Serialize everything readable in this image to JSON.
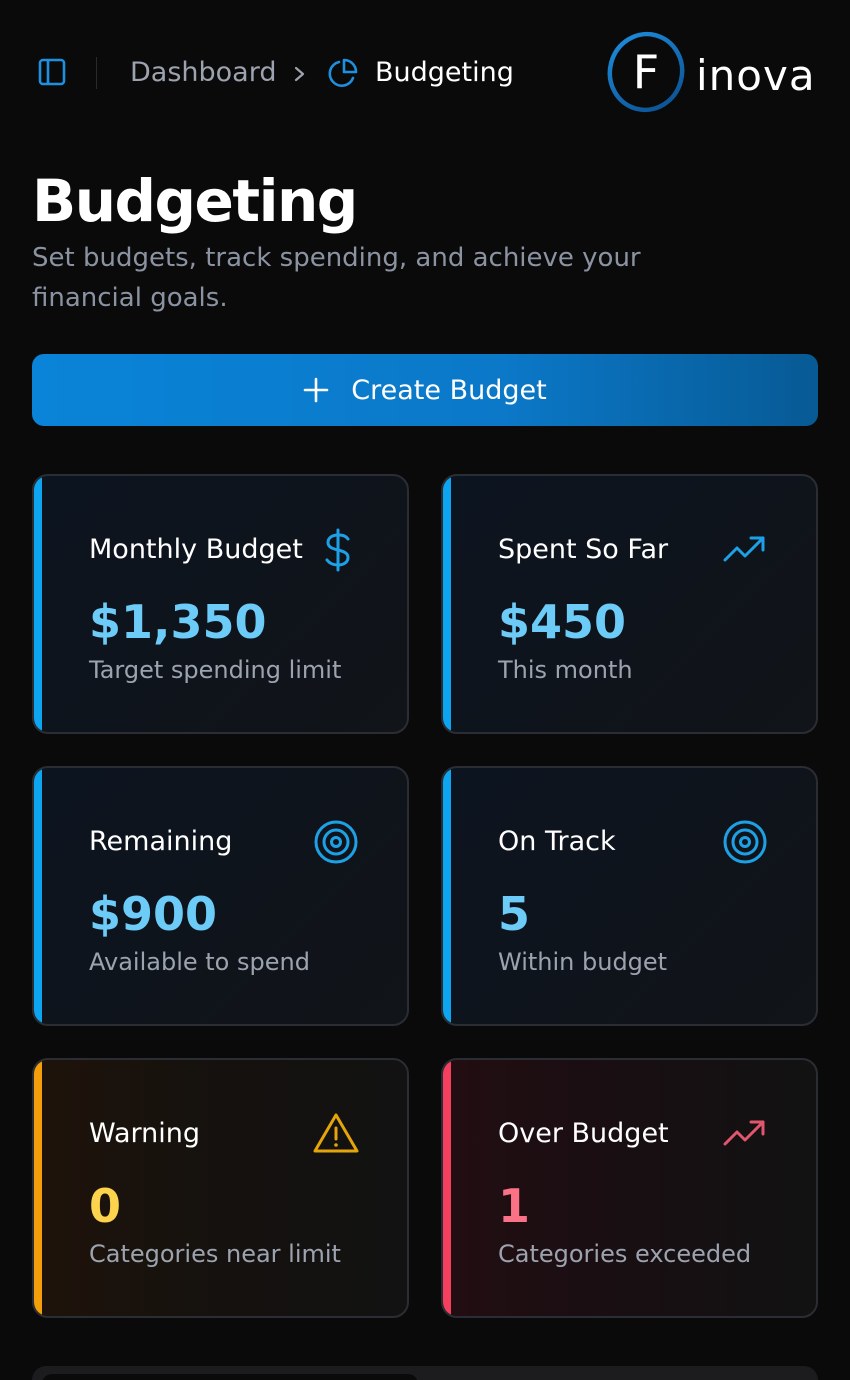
{
  "breadcrumb": {
    "root": "Dashboard",
    "current": "Budgeting"
  },
  "brand": {
    "mark": "F",
    "word": "inova"
  },
  "page": {
    "title": "Budgeting",
    "subtitle": "Set budgets, track spending, and achieve your financial goals."
  },
  "actions": {
    "create_label": "Create Budget"
  },
  "cards": [
    {
      "label": "Monthly Budget",
      "value": "$1,350",
      "caption": "Target spending limit",
      "icon": "dollar-icon",
      "tone": "blue"
    },
    {
      "label": "Spent So Far",
      "value": "$450",
      "caption": "This month",
      "icon": "trending-up-icon",
      "tone": "blue"
    },
    {
      "label": "Remaining",
      "value": "$900",
      "caption": "Available to spend",
      "icon": "target-icon",
      "tone": "blue"
    },
    {
      "label": "On Track",
      "value": "5",
      "caption": "Within budget",
      "icon": "target-icon",
      "tone": "blue"
    },
    {
      "label": "Warning",
      "value": "0",
      "caption": "Categories near limit",
      "icon": "warning-icon",
      "tone": "amber"
    },
    {
      "label": "Over Budget",
      "value": "1",
      "caption": "Categories exceeded",
      "icon": "trending-up-icon",
      "tone": "red"
    }
  ],
  "colors": {
    "accent_blue": "#0ea5f0",
    "warning": "#f59e0b",
    "danger": "#f43f5e"
  }
}
